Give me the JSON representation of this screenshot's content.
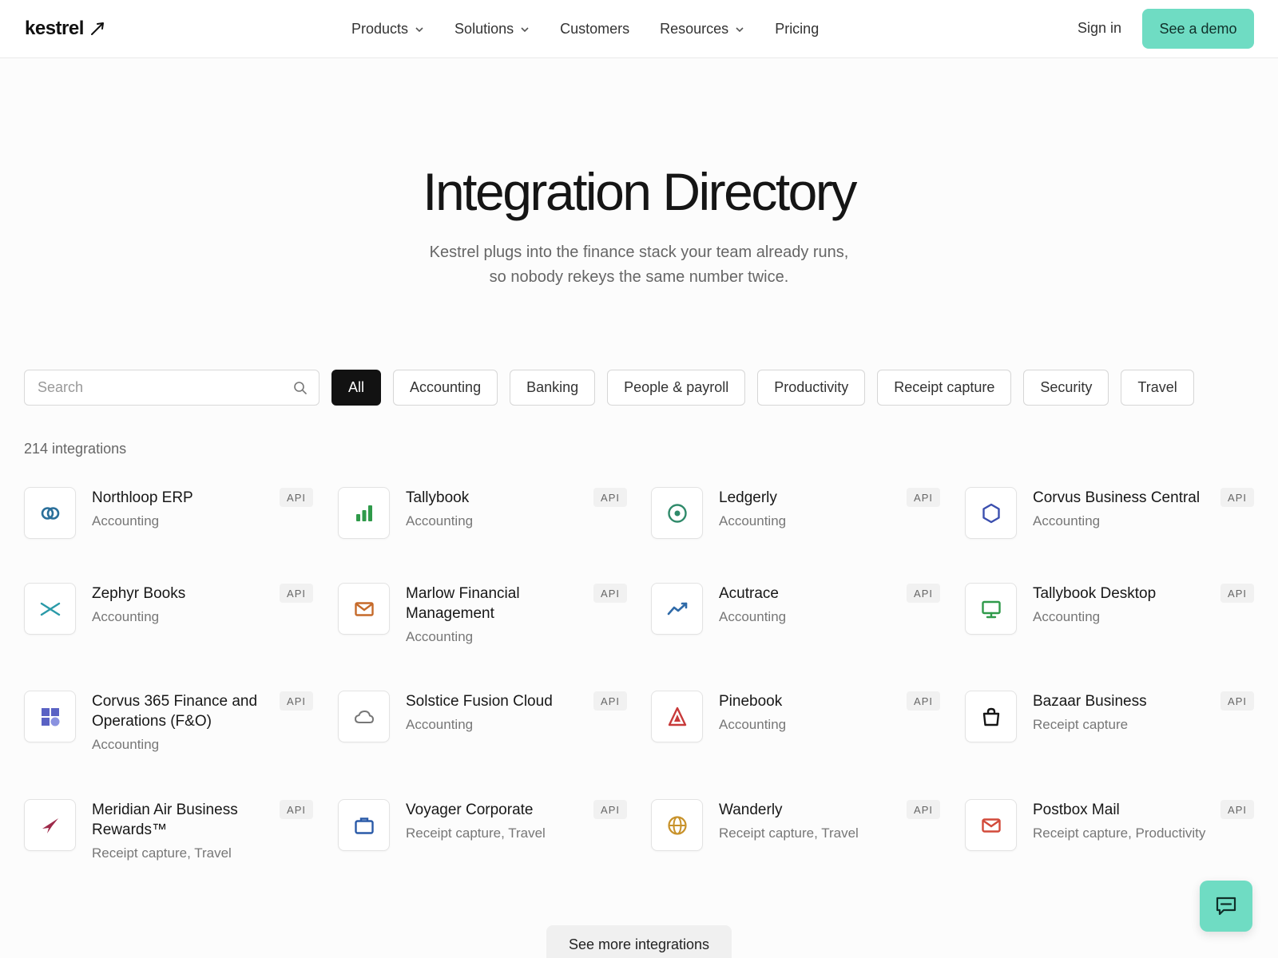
{
  "header": {
    "logo_text": "kestrel",
    "nav": [
      {
        "label": "Products",
        "dropdown": true
      },
      {
        "label": "Solutions",
        "dropdown": true
      },
      {
        "label": "Customers",
        "dropdown": false
      },
      {
        "label": "Resources",
        "dropdown": true
      },
      {
        "label": "Pricing",
        "dropdown": false
      }
    ],
    "sign_in": "Sign in",
    "demo": "See a demo"
  },
  "hero": {
    "title": "Integration Directory",
    "subtitle_line1": "Kestrel plugs into the finance stack your team already runs,",
    "subtitle_line2": "so nobody rekeys the same number twice."
  },
  "filters": {
    "search_placeholder": "Search",
    "chips": [
      {
        "label": "All",
        "active": true
      },
      {
        "label": "Accounting",
        "active": false
      },
      {
        "label": "Banking",
        "active": false
      },
      {
        "label": "People & payroll",
        "active": false
      },
      {
        "label": "Productivity",
        "active": false
      },
      {
        "label": "Receipt capture",
        "active": false
      },
      {
        "label": "Security",
        "active": false
      },
      {
        "label": "Travel",
        "active": false
      }
    ]
  },
  "results": {
    "count": "214 integrations",
    "badge": "API",
    "items": [
      {
        "name": "Northloop ERP",
        "category": "Accounting",
        "icon": "rings-icon",
        "color": "#2a6f9a"
      },
      {
        "name": "Tallybook",
        "category": "Accounting",
        "icon": "bar-chart-icon",
        "color": "#2f9a4a"
      },
      {
        "name": "Ledgerly",
        "category": "Accounting",
        "icon": "target-icon",
        "color": "#2f8a6a"
      },
      {
        "name": "Corvus Business Central",
        "category": "Accounting",
        "icon": "hexagon-icon",
        "color": "#3b4fae"
      },
      {
        "name": "Zephyr Books",
        "category": "Accounting",
        "icon": "cross-arcs-icon",
        "color": "#2a9aa8"
      },
      {
        "name": "Marlow Financial Management",
        "category": "Accounting",
        "icon": "envelope-icon",
        "color": "#c56a2a"
      },
      {
        "name": "Acutrace",
        "category": "Accounting",
        "icon": "trend-line-icon",
        "color": "#2f6aa8"
      },
      {
        "name": "Tallybook Desktop",
        "category": "Accounting",
        "icon": "monitor-icon",
        "color": "#2f9a4a"
      },
      {
        "name": "Corvus 365 Finance and Operations (F&O)",
        "category": "Accounting",
        "icon": "tiles-icon",
        "color": "#5a62c4"
      },
      {
        "name": "Solstice Fusion Cloud",
        "category": "Accounting",
        "icon": "cloud-icon",
        "color": "#777777"
      },
      {
        "name": "Pinebook",
        "category": "Accounting",
        "icon": "triangle-icon",
        "color": "#c83a3a"
      },
      {
        "name": "Bazaar Business",
        "category": "Receipt capture",
        "icon": "shopping-bag-icon",
        "color": "#151515"
      },
      {
        "name": "Meridian Air Business Rewards™",
        "category": "Receipt capture, Travel",
        "icon": "airline-icon",
        "color": "#9e2a4a"
      },
      {
        "name": "Voyager Corporate",
        "category": "Receipt capture, Travel",
        "icon": "briefcase-icon",
        "color": "#2a5aa8"
      },
      {
        "name": "Wanderly",
        "category": "Receipt capture, Travel",
        "icon": "globe-icon",
        "color": "#c8922a"
      },
      {
        "name": "Postbox Mail",
        "category": "Receipt capture, Productivity",
        "icon": "mail-icon",
        "color": "#d24a3a"
      }
    ]
  },
  "see_more": "See more integrations"
}
